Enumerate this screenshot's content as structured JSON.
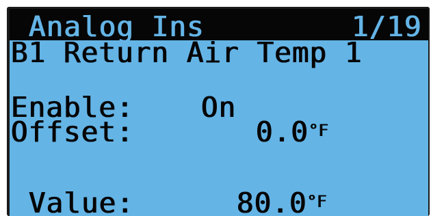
{
  "screen": {
    "title": "Analog Ins",
    "page_indicator": "1/19",
    "subtitle": "B1 Return Air Temp 1"
  },
  "fields": {
    "enable_label": "Enable:",
    "enable_value": "On",
    "offset_label": "Offset:",
    "offset_value": "0.0",
    "offset_unit": "°F",
    "value_label": "Value:",
    "value_value": "80.0",
    "value_unit": "°F"
  },
  "colors": {
    "lcd_background": "#64b4e6",
    "header_background": "#060606",
    "text": "#050505"
  }
}
